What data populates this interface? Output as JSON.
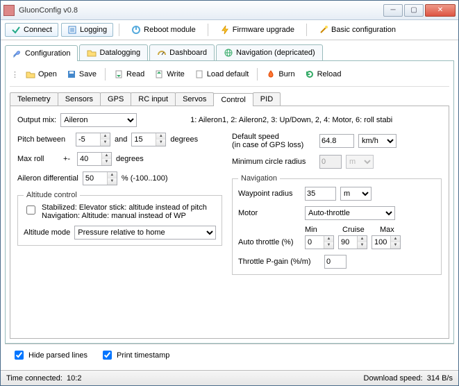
{
  "window": {
    "title": "GluonConfig v0.8"
  },
  "toolbar": {
    "connect": "Connect",
    "logging": "Logging",
    "reboot": "Reboot module",
    "firmware": "Firmware upgrade",
    "basic": "Basic configuration"
  },
  "top_tabs": {
    "configuration": "Configuration",
    "datalogging": "Datalogging",
    "dashboard": "Dashboard",
    "navigation": "Navigation (depricated)"
  },
  "filebar": {
    "open": "Open",
    "save": "Save",
    "read": "Read",
    "write": "Write",
    "load_default": "Load default",
    "burn": "Burn",
    "reload": "Reload"
  },
  "sub_tabs": {
    "telemetry": "Telemetry",
    "sensors": "Sensors",
    "gps": "GPS",
    "rc_input": "RC input",
    "servos": "Servos",
    "control": "Control",
    "pid": "PID"
  },
  "control": {
    "output_mix_label": "Output mix:",
    "output_mix_value": "Aileron",
    "output_mix_legend": "1: Aileron1, 2: Aileron2, 3: Up/Down, 2, 4: Motor, 6: roll stabi",
    "pitch_between_label": "Pitch between",
    "pitch_min": "-5",
    "and": "and",
    "pitch_max": "15",
    "degrees": "degrees",
    "max_roll_label": "Max roll",
    "max_roll_pm": "+-",
    "max_roll_value": "40",
    "aileron_diff_label": "Aileron differential",
    "aileron_diff_value": "50",
    "aileron_diff_range": "% (-100..100)",
    "altitude_control_legend": "Altitude control",
    "stabilized_text1": "Stabilized: Elevator stick: altitude instead of pitch",
    "stabilized_text2": "Navigation: Altitude: manual instead of WP",
    "altitude_mode_label": "Altitude mode",
    "altitude_mode_value": "Pressure relative to home",
    "default_speed_label1": "Default speed",
    "default_speed_label2": "(in case of GPS loss)",
    "default_speed_value": "64.8",
    "default_speed_unit": "km/h",
    "min_circle_label": "Minimum circle radius",
    "min_circle_value": "0",
    "min_circle_unit": "m",
    "navigation_legend": "Navigation",
    "waypoint_radius_label": "Waypoint radius",
    "waypoint_radius_value": "35",
    "waypoint_radius_unit": "m",
    "motor_label": "Motor",
    "motor_value": "Auto-throttle",
    "min_label": "Min",
    "cruise_label": "Cruise",
    "max_label": "Max",
    "auto_throttle_label": "Auto throttle (%)",
    "auto_throttle_min": "0",
    "auto_throttle_cruise": "90",
    "auto_throttle_max": "100",
    "throttle_pgain_label": "Throttle P-gain (%/m)",
    "throttle_pgain_value": "0"
  },
  "footer": {
    "hide_parsed": "Hide parsed lines",
    "print_timestamp": "Print timestamp"
  },
  "status": {
    "time_connected_label": "Time connected:",
    "time_connected_value": "10:2",
    "download_label": "Download speed:",
    "download_value": "314 B/s"
  },
  "colors": {
    "accent": "#2a5faa"
  }
}
